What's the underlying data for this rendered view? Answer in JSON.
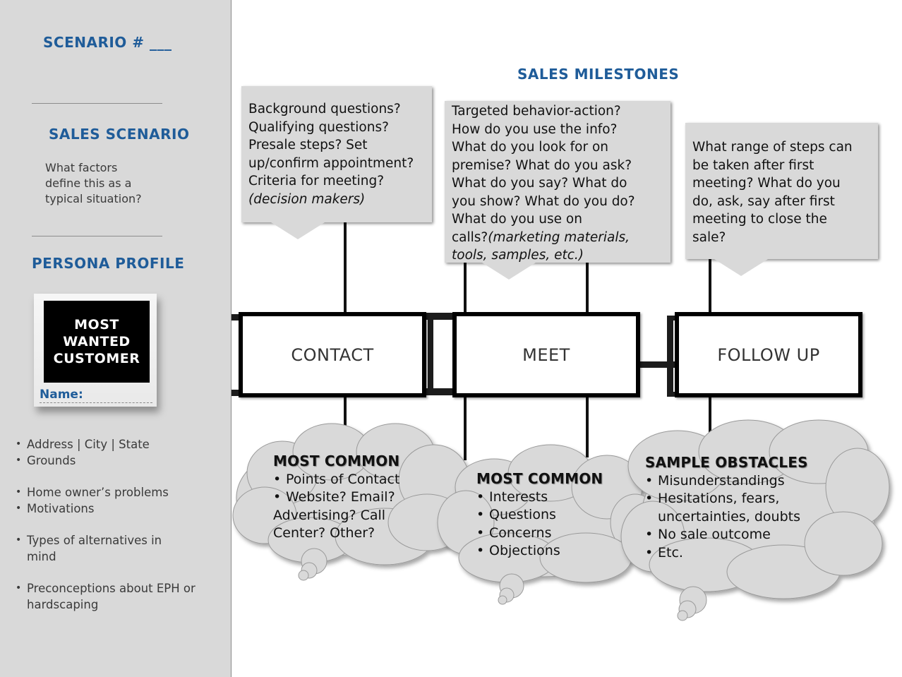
{
  "sidebar": {
    "scenario_label": "SCENARIO  # ___",
    "sales_scenario": {
      "title": "SALES SCENARIO",
      "prompt_lines": [
        "What factors",
        "define this  as a",
        "typical situation?"
      ]
    },
    "persona": {
      "title": "PERSONA PROFILE",
      "card_text_lines": [
        "MOST",
        "WANTED",
        "CUSTOMER"
      ],
      "name_label": "Name:",
      "name_value": ""
    },
    "attributes": [
      {
        "text": "Address | City | State"
      },
      {
        "text": "Grounds"
      },
      {
        "text": "Home owner’s problems",
        "group_start": true
      },
      {
        "text": "Motivations"
      },
      {
        "text": "Types of alternatives  in mind",
        "group_start": true
      },
      {
        "text": "Preconceptions about EPH or hardscaping",
        "group_start": true
      }
    ]
  },
  "main": {
    "title": "SALES MILESTONES",
    "colors": {
      "heading_blue": "#1f5c99",
      "callout_gray": "#d9d9d9",
      "cloud_gray": "#d9d9d9",
      "sidebar_gray": "#d9d9d9"
    },
    "milestones": [
      {
        "label": "CONTACT",
        "callout": {
          "text": "Background questions?\nQualifying questions?\nPresale steps? Set\nup/confirm appointment?\nCriteria for meeting?",
          "italic_text": "(decision makers)"
        },
        "cloud": {
          "heading": "MOST COMMON",
          "items": [
            "Points of Contact",
            "Website?  Email?"
          ],
          "continuation": [
            "Advertising? Call",
            "Center? Other?"
          ]
        }
      },
      {
        "label": "MEET",
        "callout": {
          "text": "Targeted behavior-action?\nHow do you use the info?\nWhat  do you look for on\npremise?  What  do you ask?\nWhat  do you say? What  do\nyou show?  What  do you do?\nWhat  do you use on\ncalls?",
          "italic_text": "(marketing materials,\ntools, samples, etc.)"
        },
        "cloud": {
          "heading": "MOST COMMON",
          "items": [
            "Interests",
            "Questions",
            "Concerns",
            "Objections"
          ],
          "continuation": []
        }
      },
      {
        "label": "FOLLOW UP",
        "callout": {
          "text": "What  range of steps can\nbe taken after first\nmeeting?  What  do you\ndo, ask, say after first\nmeeting to  close the\nsale?",
          "italic_text": ""
        },
        "cloud": {
          "heading": "SAMPLE OBSTACLES",
          "items": [
            "Misunderstandings",
            "Hesitations, fears,",
            "uncertainties, doubts",
            "No sale outcome",
            "Etc."
          ],
          "continuation": []
        }
      }
    ]
  }
}
